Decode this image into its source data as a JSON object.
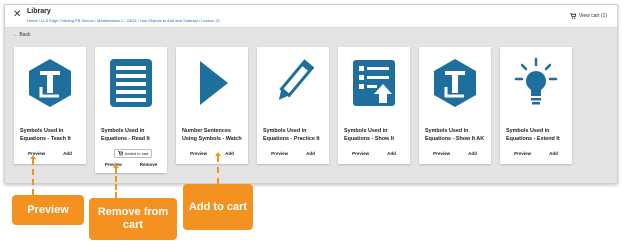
{
  "header": {
    "title": "Library",
    "breadcrumb": "Home / LLS Edge Training PB School / Mathematics 1 - 23/24 / Use Objects to Add and Subtract / Lesson 22",
    "cart_label": "View cart (1)",
    "back_label": "Back"
  },
  "cards": [
    {
      "title": "Symbols Used in Equations - Teach It",
      "icon": "library-pillar-icon",
      "a1": "Preview",
      "a2": "Add"
    },
    {
      "title": "Symbols Used in Equations - Read It",
      "icon": "document-lines-icon",
      "a1": "Preview",
      "a2": "Remove",
      "added": "Added to cart"
    },
    {
      "title": "Number Sentences Using Symbols - Watch",
      "icon": "play-icon",
      "a1": "Preview",
      "a2": "Add"
    },
    {
      "title": "Symbols Used in Equations - Practice It",
      "icon": "pencil-icon",
      "a1": "Preview",
      "a2": "Add"
    },
    {
      "title": "Symbols Used in Equations - Show It",
      "icon": "checklist-upload-icon",
      "a1": "Preview",
      "a2": "Add"
    },
    {
      "title": "Symbols Used in Equations - Show It AK",
      "icon": "library-pillar-icon",
      "a1": "Preview",
      "a2": "Add"
    },
    {
      "title": "Symbols Used in Equations - Extend It",
      "icon": "lightbulb-icon",
      "a1": "Preview",
      "a2": "Add"
    }
  ],
  "callouts": {
    "preview": "Preview",
    "remove": "Remove from cart",
    "add": "Add to cart"
  },
  "colors": {
    "accent": "#f39221",
    "icon_blue": "#1f6f9e"
  }
}
